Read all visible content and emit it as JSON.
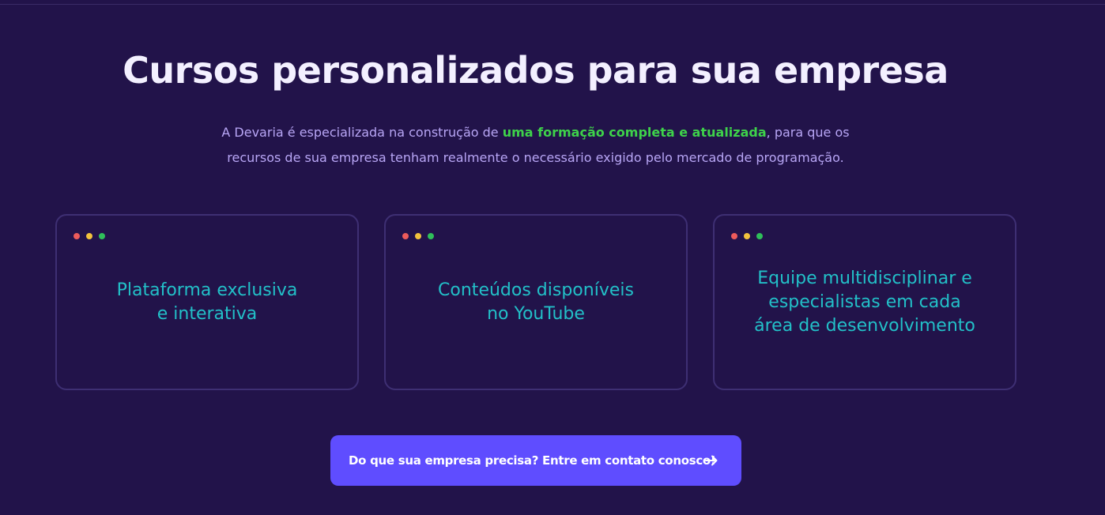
{
  "section": {
    "title": "Cursos personalizados para sua empresa",
    "description": {
      "line1_before": "A Devaria é especializada na construção de ",
      "highlight": "uma formação completa e atualizada",
      "line1_after": ", para que os",
      "line2": "recursos de sua empresa tenham realmente o necessário exigido pelo mercado de programação."
    }
  },
  "cards": [
    {
      "line1": "Plataforma exclusiva",
      "line2": "e interativa",
      "line3": ""
    },
    {
      "line1": "Conteúdos disponíveis",
      "line2": "no YouTube",
      "line3": ""
    },
    {
      "line1": "Equipe multidisciplinar e",
      "line2": "especialistas em cada",
      "line3": "área de desenvolvimento"
    }
  ],
  "cta": {
    "label": "Do que sua empresa precisa? Entre em contato conosco!",
    "icon": "arrow-right-icon"
  },
  "colors": {
    "background": "#22134a",
    "title": "#f3f0ff",
    "description": "#b8a6f5",
    "highlight": "#3ed24a",
    "card_text": "#22c0c8",
    "card_border": "#3e2f73",
    "button": "#5f4dff",
    "dot_red": "#ec5b5b",
    "dot_yellow": "#f2c23d",
    "dot_green": "#2fbf5a"
  }
}
